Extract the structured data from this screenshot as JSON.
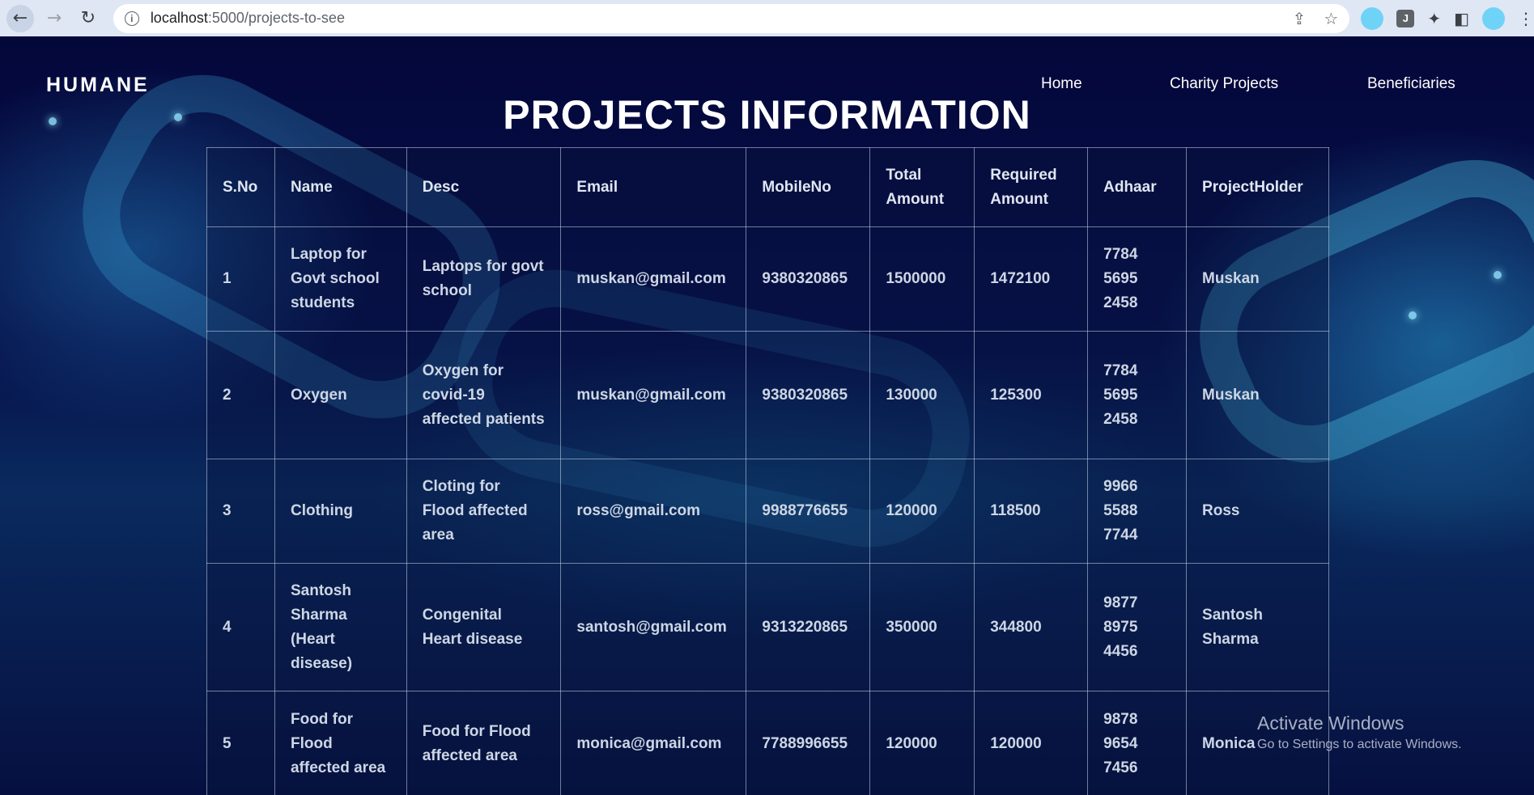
{
  "browser": {
    "url_host": "localhost",
    "url_path": ":5000/projects-to-see",
    "ext_label": "J"
  },
  "site": {
    "brand": "HUMANE",
    "nav": [
      "Home",
      "Charity Projects",
      "Beneficiaries"
    ],
    "title": "PROJECTS INFORMATION"
  },
  "table": {
    "headers": [
      "S.No",
      "Name",
      "Desc",
      "Email",
      "MobileNo",
      "Total Amount",
      "Required Amount",
      "Adhaar",
      "ProjectHolder"
    ],
    "rows": [
      [
        "1",
        "Laptop for Govt school students",
        "Laptops for govt school",
        "muskan@gmail.com",
        "9380320865",
        "1500000",
        "1472100",
        "7784 5695 2458",
        "Muskan"
      ],
      [
        "2",
        "Oxygen",
        "Oxygen for covid-19 affected patients",
        "muskan@gmail.com",
        "9380320865",
        "130000",
        "125300",
        "7784 5695 2458",
        "Muskan"
      ],
      [
        "3",
        "Clothing",
        "Cloting for Flood affected area",
        "ross@gmail.com",
        "9988776655",
        "120000",
        "118500",
        "9966 5588 7744",
        "Ross"
      ],
      [
        "4",
        "Santosh Sharma (Heart disease)",
        "Congenital Heart disease",
        "santosh@gmail.com",
        "9313220865",
        "350000",
        "344800",
        "9877 8975 4456",
        "Santosh Sharma"
      ],
      [
        "5",
        "Food for Flood affected area",
        "Food for Flood affected area",
        "monica@gmail.com",
        "7788996655",
        "120000",
        "120000",
        "9878 9654 7456",
        "Monica"
      ]
    ]
  },
  "watermark": {
    "line1": "Activate Windows",
    "line2": "Go to Settings to activate Windows."
  }
}
